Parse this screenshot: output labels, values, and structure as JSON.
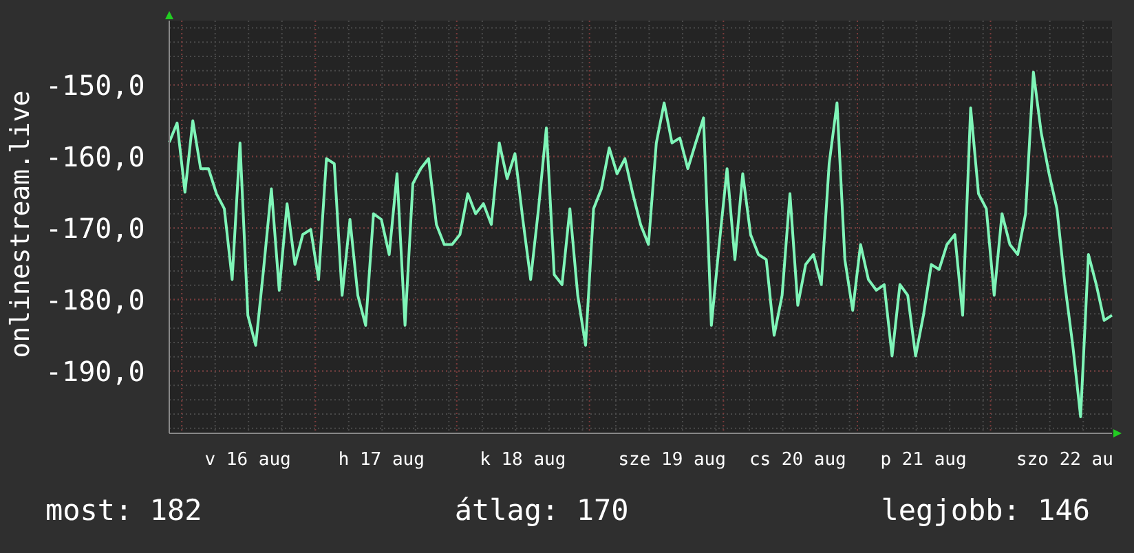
{
  "chart_data": {
    "type": "line",
    "grid": true,
    "ylim": [
      -198.7,
      -141
    ],
    "yticks": [
      {
        "value": -150,
        "label": "-150,0"
      },
      {
        "value": -160,
        "label": "-160,0"
      },
      {
        "value": -170,
        "label": "-170,0"
      },
      {
        "value": -180,
        "label": "-180,0"
      },
      {
        "value": -190,
        "label": "-190,0"
      }
    ],
    "categories": [
      null,
      null,
      null,
      null,
      null,
      null,
      null,
      null,
      null,
      null,
      "v 16 aug",
      null,
      null,
      null,
      null,
      null,
      null,
      null,
      null,
      null,
      null,
      null,
      null,
      null,
      null,
      null,
      null,
      "h 17 aug",
      null,
      null,
      null,
      null,
      null,
      null,
      null,
      null,
      null,
      null,
      null,
      null,
      null,
      null,
      null,
      null,
      null,
      "k 18 aug",
      null,
      null,
      null,
      null,
      null,
      null,
      null,
      null,
      null,
      null,
      null,
      null,
      null,
      null,
      null,
      null,
      null,
      null,
      "sze 19 aug",
      null,
      null,
      null,
      null,
      null,
      null,
      null,
      null,
      null,
      null,
      null,
      null,
      null,
      null,
      null,
      "cs 20 aug",
      null,
      null,
      null,
      null,
      null,
      null,
      null,
      null,
      null,
      null,
      null,
      null,
      null,
      null,
      null,
      "p 21 aug",
      null,
      null,
      null,
      null,
      null,
      null,
      null,
      null,
      null,
      null,
      null,
      null,
      null,
      null,
      null,
      null,
      null,
      "szo 22 au",
      null,
      null,
      null,
      null,
      null,
      null
    ],
    "series": [
      {
        "name": "onlinestream.live",
        "color": "#7ff5b8",
        "values": [
          -158,
          -155.3,
          -165,
          -155,
          -161.7,
          -161.7,
          -165.2,
          -167.3,
          -177.2,
          -158.1,
          -182.2,
          -186.4,
          -175.8,
          -164.5,
          -178.7,
          -166.6,
          -175.1,
          -170.9,
          -170.2,
          -177.2,
          -160.3,
          -161,
          -179.4,
          -168.8,
          -179.4,
          -183.6,
          -168,
          -168.8,
          -173.7,
          -162.4,
          -183.6,
          -163.8,
          -161.7,
          -160.3,
          -169.5,
          -172.3,
          -172.3,
          -170.9,
          -165.2,
          -168,
          -166.6,
          -169.5,
          -158.1,
          -163.1,
          -159.6,
          -168.8,
          -177.2,
          -167.3,
          -156,
          -176.5,
          -177.9,
          -167.3,
          -179.4,
          -186.4,
          -167.3,
          -164.5,
          -158.8,
          -162.4,
          -160.3,
          -165.2,
          -169.5,
          -172.3,
          -158.1,
          -152.5,
          -158.1,
          -157.4,
          -161.7,
          -158.1,
          -154.6,
          -183.6,
          -172.3,
          -161.7,
          -174.4,
          -162.4,
          -170.9,
          -173.7,
          -174.4,
          -185,
          -179.4,
          -165.2,
          -180.8,
          -175.1,
          -173.7,
          -177.9,
          -161,
          -152.5,
          -174.4,
          -181.5,
          -172.3,
          -177.2,
          -178.7,
          -177.9,
          -187.9,
          -177.9,
          -179.4,
          -187.9,
          -182.2,
          -175.1,
          -175.8,
          -172.3,
          -170.9,
          -182.2,
          -153.2,
          -165.2,
          -167.3,
          -179.4,
          -168,
          -172.3,
          -173.7,
          -168,
          -148.2,
          -156.7,
          -162.4,
          -167.3,
          -177.9,
          -186.4,
          -196.4,
          -173.7,
          -177.9,
          -182.9,
          -182.2
        ]
      }
    ]
  },
  "summary": [
    {
      "label": "most: 182"
    },
    {
      "label": "átlag: 170"
    },
    {
      "label": "legjobb: 146"
    }
  ]
}
